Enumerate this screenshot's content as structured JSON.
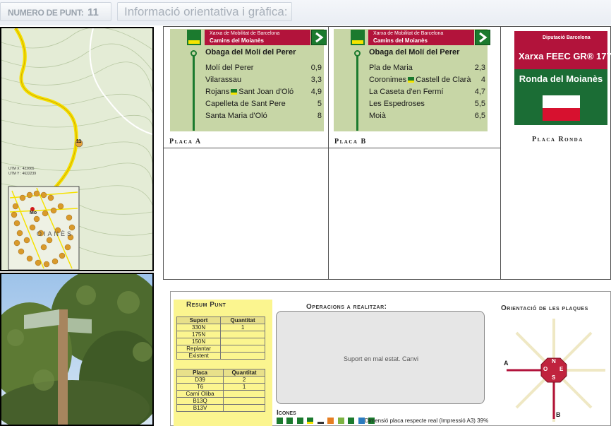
{
  "header": {
    "punt_label": "NUMERO DE PUNT:",
    "punt_number": "11",
    "info_title": "Informació orientativa i gràfica:"
  },
  "map": {
    "marker": "11",
    "utm_x_label": "UTM X :",
    "utm_x": "422665",
    "utm_y_label": "UTM Y :",
    "utm_y": "4622239",
    "inset_label1": "Mo",
    "inset_label2": "OIANÈS"
  },
  "plates": {
    "a": {
      "org_line1": "Xarxa de Mobilitat de Barcelona",
      "org_line2": "Camins del Moianès",
      "title": "Obaga del Molí del Perer",
      "rows": [
        {
          "name": "Molí del Perer",
          "km": "0,9"
        },
        {
          "name": "Vilarassau",
          "km": "3,3"
        },
        {
          "name": "Rojans",
          "name2": "Sant Joan d'Oló",
          "km": "4,9"
        },
        {
          "name": "Capelleta de Sant Pere",
          "km": "5"
        },
        {
          "name": "Santa Maria d'Oló",
          "km": "8"
        }
      ],
      "label": "Placa A"
    },
    "b": {
      "org_line1": "Xarxa de Mobilitat de Barcelona",
      "org_line2": "Camins del Moianès",
      "title": "Obaga del Molí del Perer",
      "rows": [
        {
          "name": "Pla de Maria",
          "km": "2,3"
        },
        {
          "name": "Coronimes",
          "name2": "Castell de Clarà",
          "km": "4"
        },
        {
          "name": "La Caseta d'en Fermí",
          "km": "4,7"
        },
        {
          "name": "Les Espedroses",
          "km": "5,5"
        },
        {
          "name": "Moià",
          "km": "6,5"
        }
      ],
      "label": "Placa B"
    },
    "ronda": {
      "org": "Diputació Barcelona",
      "network": "Xarxa FEEC GR® 177",
      "name": "Ronda del Moianès",
      "label": "Placa Ronda"
    }
  },
  "resum": {
    "title": "Resum Punt",
    "suport_header": [
      "Suport",
      "Quantitat"
    ],
    "suport_rows": [
      [
        "330N",
        "1"
      ],
      [
        "175N",
        ""
      ],
      [
        "150N",
        ""
      ],
      [
        "Replantar",
        ""
      ],
      [
        "Existent",
        ""
      ]
    ],
    "placa_header": [
      "Placa",
      "Quantitat"
    ],
    "placa_rows": [
      [
        "D39",
        "2"
      ],
      [
        "T6",
        "1"
      ],
      [
        "Camí Oliba",
        ""
      ],
      [
        "B13Q",
        ""
      ],
      [
        "B13V",
        ""
      ]
    ]
  },
  "operacions": {
    "title": "Operacions a realitzar:",
    "text": "Suport en mal estat. Canvi"
  },
  "icones": {
    "title": "Icones",
    "dimension_text": "Dimensió placa respecte real  (Impressió A3) 39%"
  },
  "orientacio": {
    "title": "Orientació de les plaques",
    "label_a": "A",
    "label_b": "B",
    "n": "N",
    "o": "O",
    "e": "E",
    "s": "S"
  },
  "colors": {
    "plate_bg": "#c7d6a6",
    "brand_red": "#b2133b",
    "brand_green": "#1b7a2e",
    "resum_yellow": "#fbf58f"
  }
}
